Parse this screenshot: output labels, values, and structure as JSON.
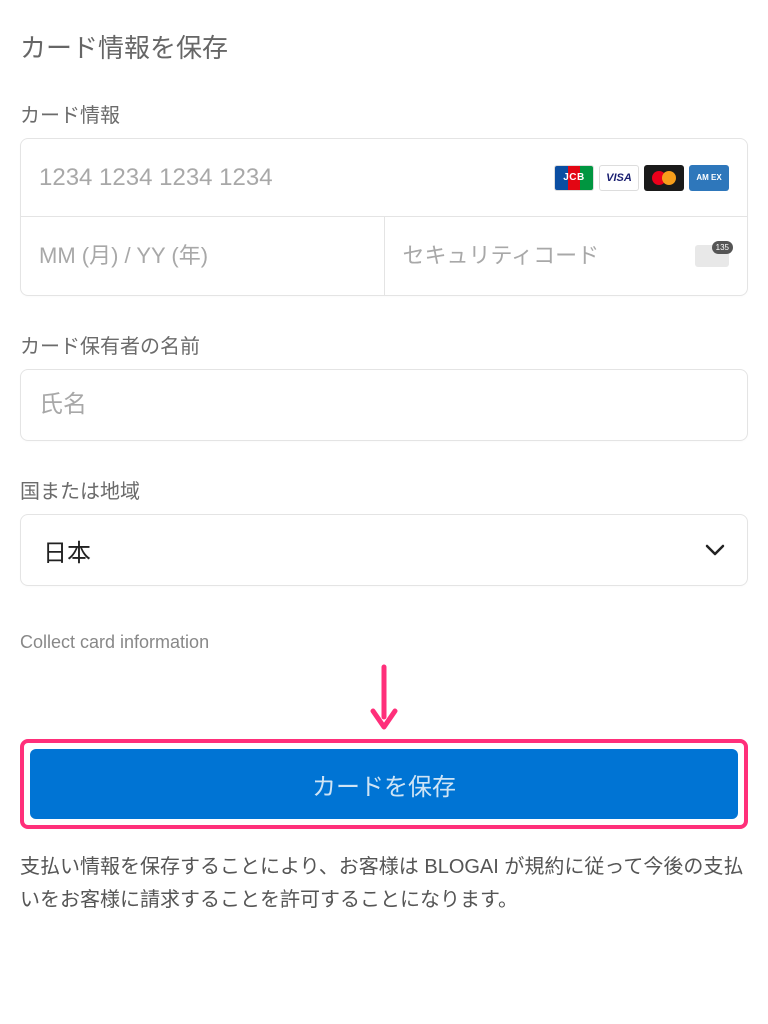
{
  "title": "カード情報を保存",
  "card_info": {
    "label": "カード情報",
    "number_placeholder": "1234 1234 1234 1234",
    "expiry_placeholder": "MM (月) / YY (年)",
    "cvc_placeholder": "セキュリティコード"
  },
  "brands": {
    "jcb": "JCB",
    "visa": "VISA",
    "amex": "AM\nEX"
  },
  "cardholder": {
    "label": "カード保有者の名前",
    "placeholder": "氏名"
  },
  "country": {
    "label": "国または地域",
    "value": "日本"
  },
  "caption": "Collect card information",
  "save_button": "カードを保存",
  "disclaimer": "支払い情報を保存することにより、お客様は BLOGAI が規約に従って今後の支払いをお客様に請求することを許可することになります。",
  "colors": {
    "highlight": "#ff2f7a",
    "primary": "#0074d4"
  }
}
